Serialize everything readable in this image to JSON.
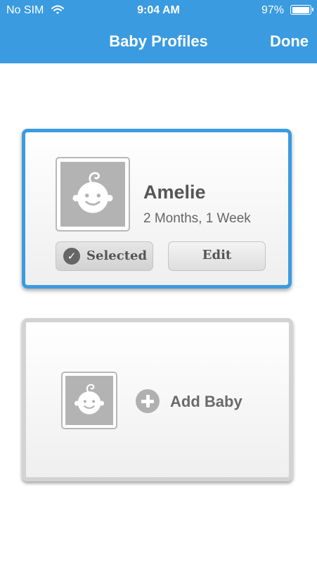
{
  "status_bar": {
    "carrier": "No SIM",
    "wifi_icon": "wifi-icon",
    "time": "9:04 AM",
    "battery_percent": "97%",
    "battery_level": 0.97
  },
  "nav": {
    "title": "Baby Profiles",
    "done_label": "Done"
  },
  "profiles": [
    {
      "name": "Amelie",
      "age": "2 Months, 1 Week",
      "selected_label": "Selected",
      "edit_label": "Edit",
      "avatar_icon": "baby-face-icon"
    }
  ],
  "add_baby": {
    "label": "Add Baby",
    "icon": "plus-circle-icon"
  },
  "colors": {
    "accent": "#3a9be0",
    "avatar_gray": "#b3b3b3",
    "add_card_border": "#d3d3d3"
  }
}
